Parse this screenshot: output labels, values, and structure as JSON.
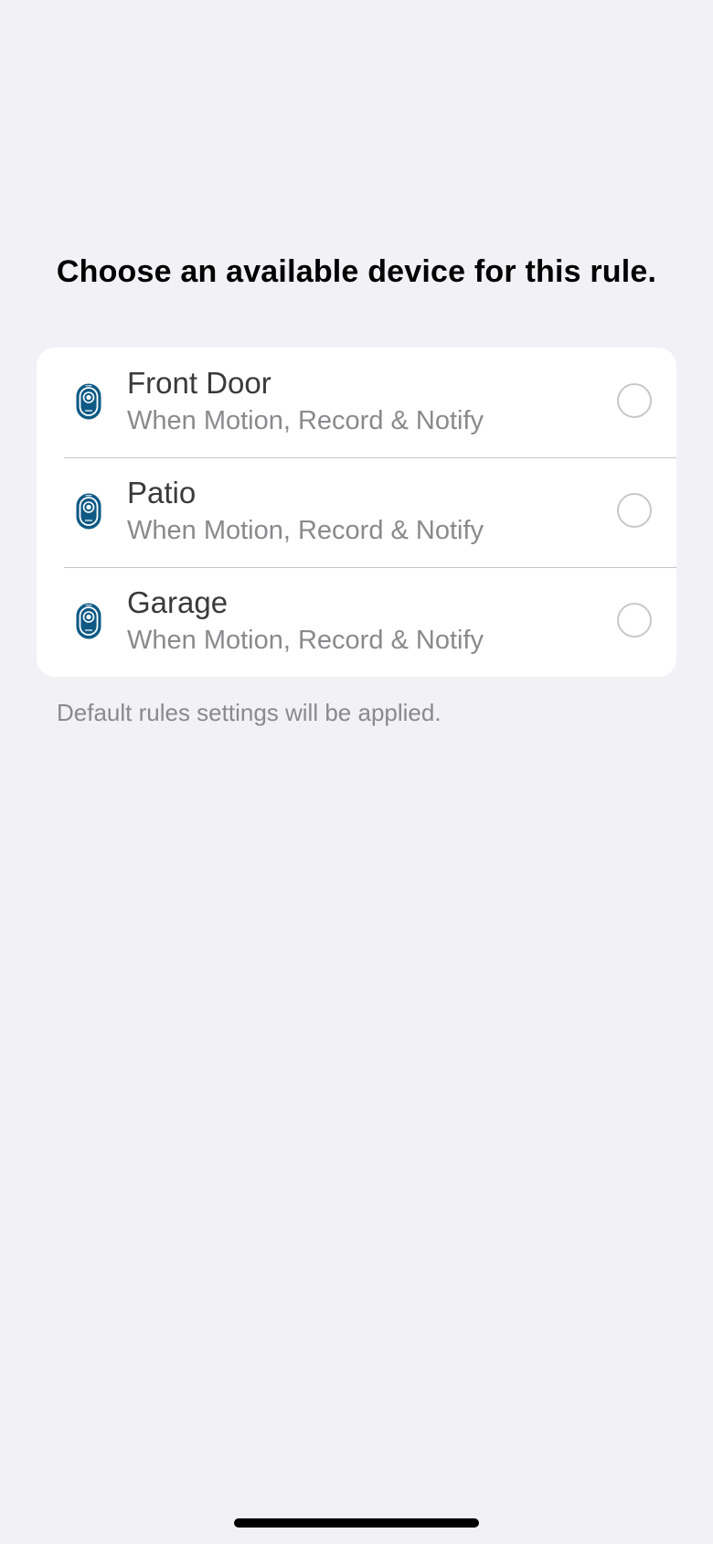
{
  "header": {
    "title": "Choose an available device for this rule."
  },
  "devices": [
    {
      "name": "Front Door",
      "rule": "When Motion, Record & Notify",
      "selected": false,
      "icon": "camera-icon"
    },
    {
      "name": "Patio",
      "rule": "When Motion, Record & Notify",
      "selected": false,
      "icon": "camera-icon"
    },
    {
      "name": "Garage",
      "rule": "When Motion, Record & Notify",
      "selected": false,
      "icon": "camera-icon"
    }
  ],
  "footnote": "Default rules settings will be applied.",
  "colors": {
    "background": "#f1f1f6",
    "card": "#ffffff",
    "icon": "#0e5a85",
    "radio_border": "#c7c7cc",
    "secondary_text": "#8a8a8e"
  }
}
